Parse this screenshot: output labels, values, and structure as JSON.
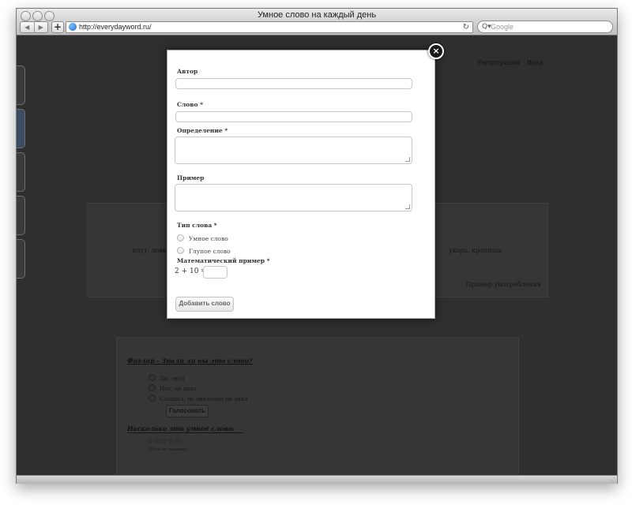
{
  "browser": {
    "title": "Умное слово на каждый день",
    "url": "http://everydayword.ru/",
    "search_placeholder": "Google",
    "back_glyph": "◀",
    "forward_glyph": "▶",
    "add_glyph": "+",
    "reload_glyph": "↻",
    "icons": [
      "back-arrow-icon",
      "forward-arrow-icon",
      "plus-icon",
      "globe-icon",
      "reload-icon",
      "search-icon"
    ]
  },
  "background_page": {
    "top_links": [
      "Регистрация",
      "Вход"
    ],
    "word_panel": {
      "text_left": "плут, ловкий об",
      "text_right": "укарь, кропиша",
      "example_link": "Пример употребления"
    },
    "vote": {
      "question": "Фиглар - Знали ли вы это слово?",
      "options": [
        "Да, знал",
        "Нет, не знал",
        "Слышал, но значение не знал"
      ],
      "button": "Голосовать",
      "rating_question": "Насколько это умное слово:",
      "stars": "☆☆☆☆☆",
      "rating_note": "(Пока не оценено)"
    }
  },
  "modal": {
    "close_glyph": "×",
    "fields": {
      "author_label": "Автор",
      "word_label": "Слово *",
      "definition_label": "Определение *",
      "example_label": "Пример",
      "type_label": "Тип слова *",
      "type_options": [
        "Умное слово",
        "Глупое слово"
      ],
      "math_label": "Математический пример *",
      "math_question": "2 + 10 ="
    },
    "submit_label": "Добавить слово"
  }
}
